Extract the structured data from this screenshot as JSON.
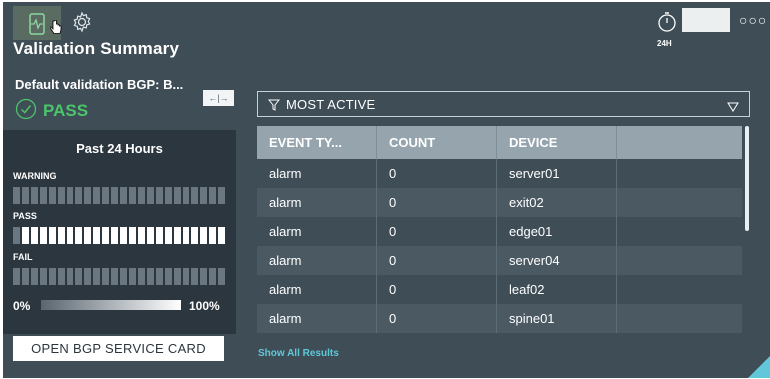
{
  "header": {
    "title": "Validation Summary",
    "time_label": "24H",
    "more": "○○○"
  },
  "left": {
    "validation_name": "Default validation BGP: B...",
    "status": "PASS",
    "expand": "←|→",
    "period": "Past 24 Hours",
    "warning_label": "WARNING",
    "pass_label": "PASS",
    "fail_label": "FAIL",
    "legend_min": "0%",
    "legend_max": "100%",
    "open_button": "OPEN BGP SERVICE CARD",
    "colors": {
      "pass": "#4cc46a",
      "bar_empty": "#6b7780",
      "bar_full": "#ffffff"
    }
  },
  "right": {
    "filter": "MOST ACTIVE",
    "columns": [
      "EVENT TY...",
      "COUNT",
      "DEVICE",
      ""
    ],
    "rows": [
      [
        "alarm",
        "0",
        "server01",
        ""
      ],
      [
        "alarm",
        "0",
        "exit02",
        ""
      ],
      [
        "alarm",
        "0",
        "edge01",
        ""
      ],
      [
        "alarm",
        "0",
        "server04",
        ""
      ],
      [
        "alarm",
        "0",
        "leaf02",
        ""
      ],
      [
        "alarm",
        "0",
        "spine01",
        ""
      ]
    ],
    "show_all": "Show All Results"
  }
}
